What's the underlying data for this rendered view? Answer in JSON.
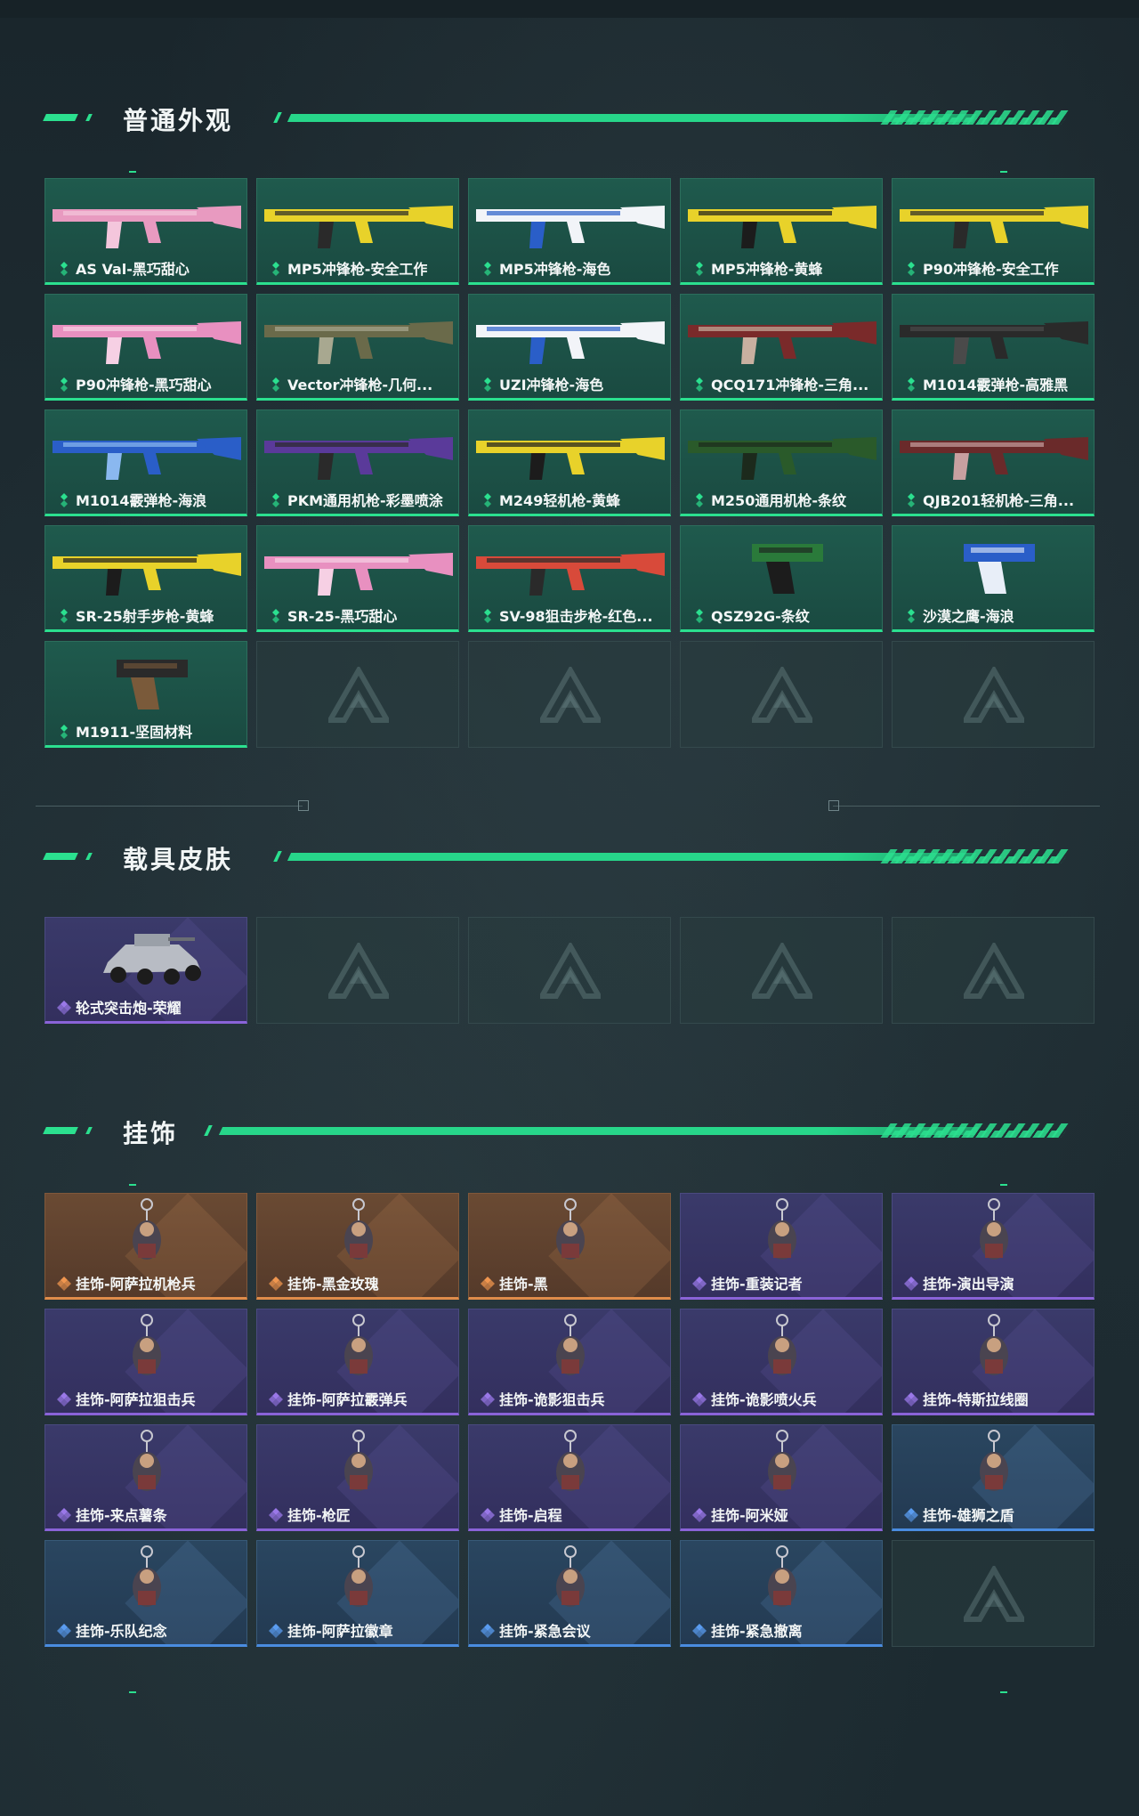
{
  "sections": {
    "weapons": {
      "title": "普通外观",
      "items": [
        {
          "label": "AS Val-黑巧甜心",
          "rarity": "green",
          "art": "pink-rifle"
        },
        {
          "label": "MP5冲锋枪-安全工作",
          "rarity": "green",
          "art": "yellow-smg"
        },
        {
          "label": "MP5冲锋枪-海色",
          "rarity": "green",
          "art": "blue-smg"
        },
        {
          "label": "MP5冲锋枪-黄蜂",
          "rarity": "green",
          "art": "wasp-smg"
        },
        {
          "label": "P90冲锋枪-安全工作",
          "rarity": "green",
          "art": "yellow-p90"
        },
        {
          "label": "P90冲锋枪-黑巧甜心",
          "rarity": "green",
          "art": "pink-p90"
        },
        {
          "label": "Vector冲锋枪-几何...",
          "rarity": "green",
          "art": "camo-smg"
        },
        {
          "label": "UZI冲锋枪-海色",
          "rarity": "green",
          "art": "blue-uzi"
        },
        {
          "label": "QCQ171冲锋枪-三角...",
          "rarity": "green",
          "art": "red-smg"
        },
        {
          "label": "M1014霰弹枪-高雅黑",
          "rarity": "green",
          "art": "black-shotgun"
        },
        {
          "label": "M1014霰弹枪-海浪",
          "rarity": "green",
          "art": "wave-shotgun"
        },
        {
          "label": "PKM通用机枪-彩墨喷涂",
          "rarity": "green",
          "art": "purple-mg"
        },
        {
          "label": "M249轻机枪-黄蜂",
          "rarity": "green",
          "art": "wasp-mg"
        },
        {
          "label": "M250通用机枪-条纹",
          "rarity": "green",
          "art": "green-mg"
        },
        {
          "label": "QJB201轻机枪-三角...",
          "rarity": "green",
          "art": "red-mg"
        },
        {
          "label": "SR-25射手步枪-黄蜂",
          "rarity": "green",
          "art": "wasp-rifle"
        },
        {
          "label": "SR-25-黑巧甜心",
          "rarity": "green",
          "art": "pink-sr"
        },
        {
          "label": "SV-98狙击步枪-红色...",
          "rarity": "green",
          "art": "red-sniper"
        },
        {
          "label": "QSZ92G-条纹",
          "rarity": "green",
          "art": "green-pistol"
        },
        {
          "label": "沙漠之鹰-海浪",
          "rarity": "green",
          "art": "wave-pistol"
        },
        {
          "label": "M1911-坚固材料",
          "rarity": "green",
          "art": "black-pistol"
        },
        {
          "label": "",
          "rarity": "empty"
        },
        {
          "label": "",
          "rarity": "empty"
        },
        {
          "label": "",
          "rarity": "empty"
        },
        {
          "label": "",
          "rarity": "empty"
        }
      ]
    },
    "vehicles": {
      "title": "载具皮肤",
      "items": [
        {
          "label": "轮式突击炮-荣耀",
          "rarity": "purple",
          "art": "vehicle"
        },
        {
          "label": "",
          "rarity": "empty"
        },
        {
          "label": "",
          "rarity": "empty"
        },
        {
          "label": "",
          "rarity": "empty"
        },
        {
          "label": "",
          "rarity": "empty"
        }
      ]
    },
    "charms": {
      "title": "挂饰",
      "items": [
        {
          "label": "挂饰-阿萨拉机枪兵",
          "rarity": "orange",
          "art": "charm"
        },
        {
          "label": "挂饰-黑金玫瑰",
          "rarity": "orange",
          "art": "charm"
        },
        {
          "label": "挂饰-黑",
          "rarity": "orange",
          "art": "charm"
        },
        {
          "label": "挂饰-重装记者",
          "rarity": "purple",
          "art": "charm"
        },
        {
          "label": "挂饰-演出导演",
          "rarity": "purple",
          "art": "charm"
        },
        {
          "label": "挂饰-阿萨拉狙击兵",
          "rarity": "purple",
          "art": "charm"
        },
        {
          "label": "挂饰-阿萨拉霰弹兵",
          "rarity": "purple",
          "art": "charm"
        },
        {
          "label": "挂饰-诡影狙击兵",
          "rarity": "purple",
          "art": "charm"
        },
        {
          "label": "挂饰-诡影喷火兵",
          "rarity": "purple",
          "art": "charm"
        },
        {
          "label": "挂饰-特斯拉线圈",
          "rarity": "purple",
          "art": "charm"
        },
        {
          "label": "挂饰-来点薯条",
          "rarity": "purple",
          "art": "charm"
        },
        {
          "label": "挂饰-枪匠",
          "rarity": "purple",
          "art": "charm"
        },
        {
          "label": "挂饰-启程",
          "rarity": "purple",
          "art": "charm"
        },
        {
          "label": "挂饰-阿米娅",
          "rarity": "purple",
          "art": "charm"
        },
        {
          "label": "挂饰-雄狮之盾",
          "rarity": "blue",
          "art": "charm"
        },
        {
          "label": "挂饰-乐队纪念",
          "rarity": "blue",
          "art": "charm"
        },
        {
          "label": "挂饰-阿萨拉徽章",
          "rarity": "blue",
          "art": "charm"
        },
        {
          "label": "挂饰-紧急会议",
          "rarity": "blue",
          "art": "charm"
        },
        {
          "label": "挂饰-紧急撤离",
          "rarity": "blue",
          "art": "charm"
        },
        {
          "label": "",
          "rarity": "empty"
        }
      ]
    }
  },
  "colors": {
    "accent": "#2be08f",
    "green_rarity": "#2be08f",
    "purple_rarity": "#8a63d8",
    "orange_rarity": "#e08c4a",
    "blue_rarity": "#4a8ce0"
  }
}
